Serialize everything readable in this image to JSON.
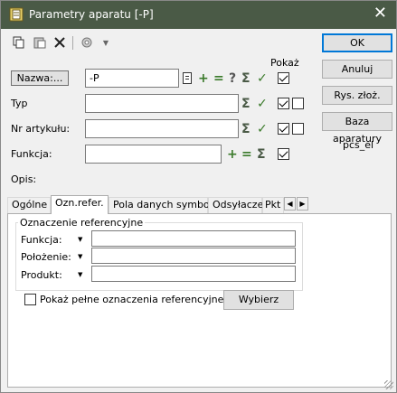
{
  "window": {
    "title": "Parametry aparatu [-P]",
    "close_glyph": "✕"
  },
  "toolbar": {
    "icons": [
      "copy-icon",
      "paste-icon",
      "cut-icon",
      "settings-icon",
      "dropdown-icon"
    ]
  },
  "pokaz_label": "Pokaż",
  "fields": {
    "nazwa": {
      "label": "Nazwa:...",
      "value": "-P"
    },
    "typ": {
      "label": "Typ",
      "value": ""
    },
    "nr_artykulu": {
      "label": "Nr artykułu:",
      "value": ""
    },
    "funkcja": {
      "label": "Funkcja:",
      "value": ""
    },
    "opis": {
      "label": "Opis:"
    }
  },
  "right_buttons": {
    "ok": "OK",
    "anuluj": "Anuluj",
    "rys_zloz": "Rys. złoż.",
    "baza": "Baza aparatury"
  },
  "pcs_el": "pcs_el",
  "tabs": [
    "Ogólne",
    "Ozn.refer.",
    "Pola danych symbolu",
    "Odsyłacze",
    "Pkt"
  ],
  "active_tab": "Ozn.refer.",
  "panel": {
    "group_title": "Oznaczenie referencyjne",
    "rows": [
      {
        "label": "Funkcja:",
        "value": ""
      },
      {
        "label": "Położenie:",
        "value": ""
      },
      {
        "label": "Produkt:",
        "value": ""
      }
    ],
    "show_full_label": "Pokaż pełne oznaczenia referencyjne",
    "wybierz": "Wybierz"
  },
  "colors": {
    "titlebar": "#4a5a46",
    "accent": "#0078d7"
  }
}
